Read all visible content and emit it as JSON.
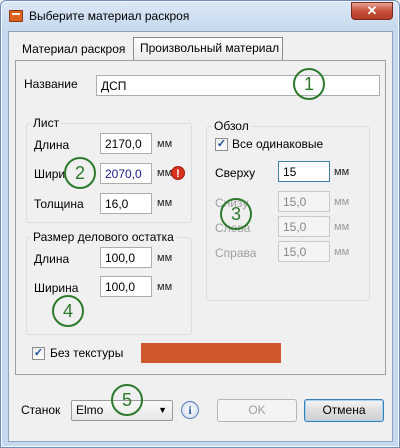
{
  "window": {
    "title": "Выберите материал раскроя",
    "close_glyph": "✕"
  },
  "tabs": [
    {
      "label": "Материал раскроя"
    },
    {
      "label": "Произвольный материал"
    }
  ],
  "name": {
    "label": "Название",
    "value": "ДСП"
  },
  "sheet": {
    "title": "Лист",
    "length_label": "Длина",
    "length_value": "2170,0",
    "width_label": "Шири",
    "width_value": "2070,0",
    "thickness_label": "Толщина",
    "thickness_value": "16,0",
    "unit": "мм",
    "warning_glyph": "!"
  },
  "edging": {
    "title": "Обзол",
    "all_same_label": "Все одинаковые",
    "all_same_checked": true,
    "top_label": "Сверху",
    "top_value": "15",
    "bottom_label": "Снизу",
    "bottom_value": "15,0",
    "left_label": "Слева",
    "left_value": "15,0",
    "right_label": "Справа",
    "right_value": "15,0",
    "unit": "мм"
  },
  "offcut": {
    "title": "Размер делового остатка",
    "length_label": "Длина",
    "length_value": "100,0",
    "width_label": "Ширина",
    "width_value": "100,0",
    "unit": "мм"
  },
  "texture": {
    "label": "Без текстуры",
    "checked": true,
    "color": "#d0562b"
  },
  "footer": {
    "machine_label": "Станок",
    "machine_value": "Elmo",
    "info_glyph": "i",
    "ok_label": "OK",
    "cancel_label": "Отмена"
  },
  "badges": [
    "1",
    "2",
    "3",
    "4",
    "5"
  ],
  "colors": {
    "badge": "#2d7a2d",
    "swatch": "#d0562b"
  }
}
